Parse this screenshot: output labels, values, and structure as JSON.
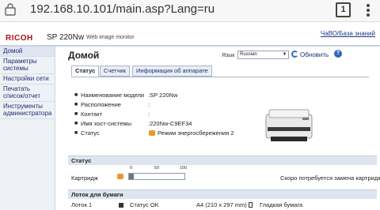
{
  "browser": {
    "url": "192.168.10.101/main.asp?Lang=ru",
    "tab_count": "1"
  },
  "header": {
    "brand": "RICOH",
    "model": "SP 220Nw",
    "product_label": "Web image monitor",
    "faq_link": "ЧаВО/База знаний"
  },
  "sidebar": {
    "items": [
      {
        "label": "Домой"
      },
      {
        "label": "Параметры системы"
      },
      {
        "label": "Настройки сети"
      },
      {
        "label": "Печатать список/отчет"
      },
      {
        "label": "Инструменты администратора"
      }
    ]
  },
  "main": {
    "title": "Домой",
    "language_label": "Язык",
    "language_value": "Russian",
    "refresh_label": "Обновить",
    "tabs": [
      {
        "label": "Статус"
      },
      {
        "label": "Счетчик"
      },
      {
        "label": "Информация об аппарате"
      }
    ],
    "info": [
      {
        "key": "Наименование модели",
        "value": ":SP 220Nw"
      },
      {
        "key": "Расположение",
        "value": ":"
      },
      {
        "key": "Контакт",
        "value": ":"
      },
      {
        "key": "Имя хост-системы",
        "value": ":220Nw-C9EF34"
      },
      {
        "key": "Статус",
        "value": "Режим энергосбережения 2"
      }
    ],
    "status_section": {
      "title": "Статус",
      "cartridge_label": "Картридж",
      "scale": [
        "0",
        "50",
        "100"
      ],
      "toner_level": 0.08,
      "message": "Скоро потребуется замена картриджа"
    },
    "tray_section": {
      "title": "Лоток для бумаги",
      "tray_name": "Лоток 1",
      "tray_status": "Статус OK",
      "paper_size": "A4 (210 x 297 mm)",
      "paper_type": "Гладкая бумага"
    }
  },
  "colors": {
    "brand_red": "#b01018",
    "link_blue": "#1d2f6f",
    "section_bg": "#dfe5ef",
    "warning": "#e59a2c"
  },
  "icons": {
    "status": "energy-saver-icon",
    "cartridge_warning": "warning-icon",
    "refresh": "refresh-icon",
    "help": "help-icon"
  }
}
